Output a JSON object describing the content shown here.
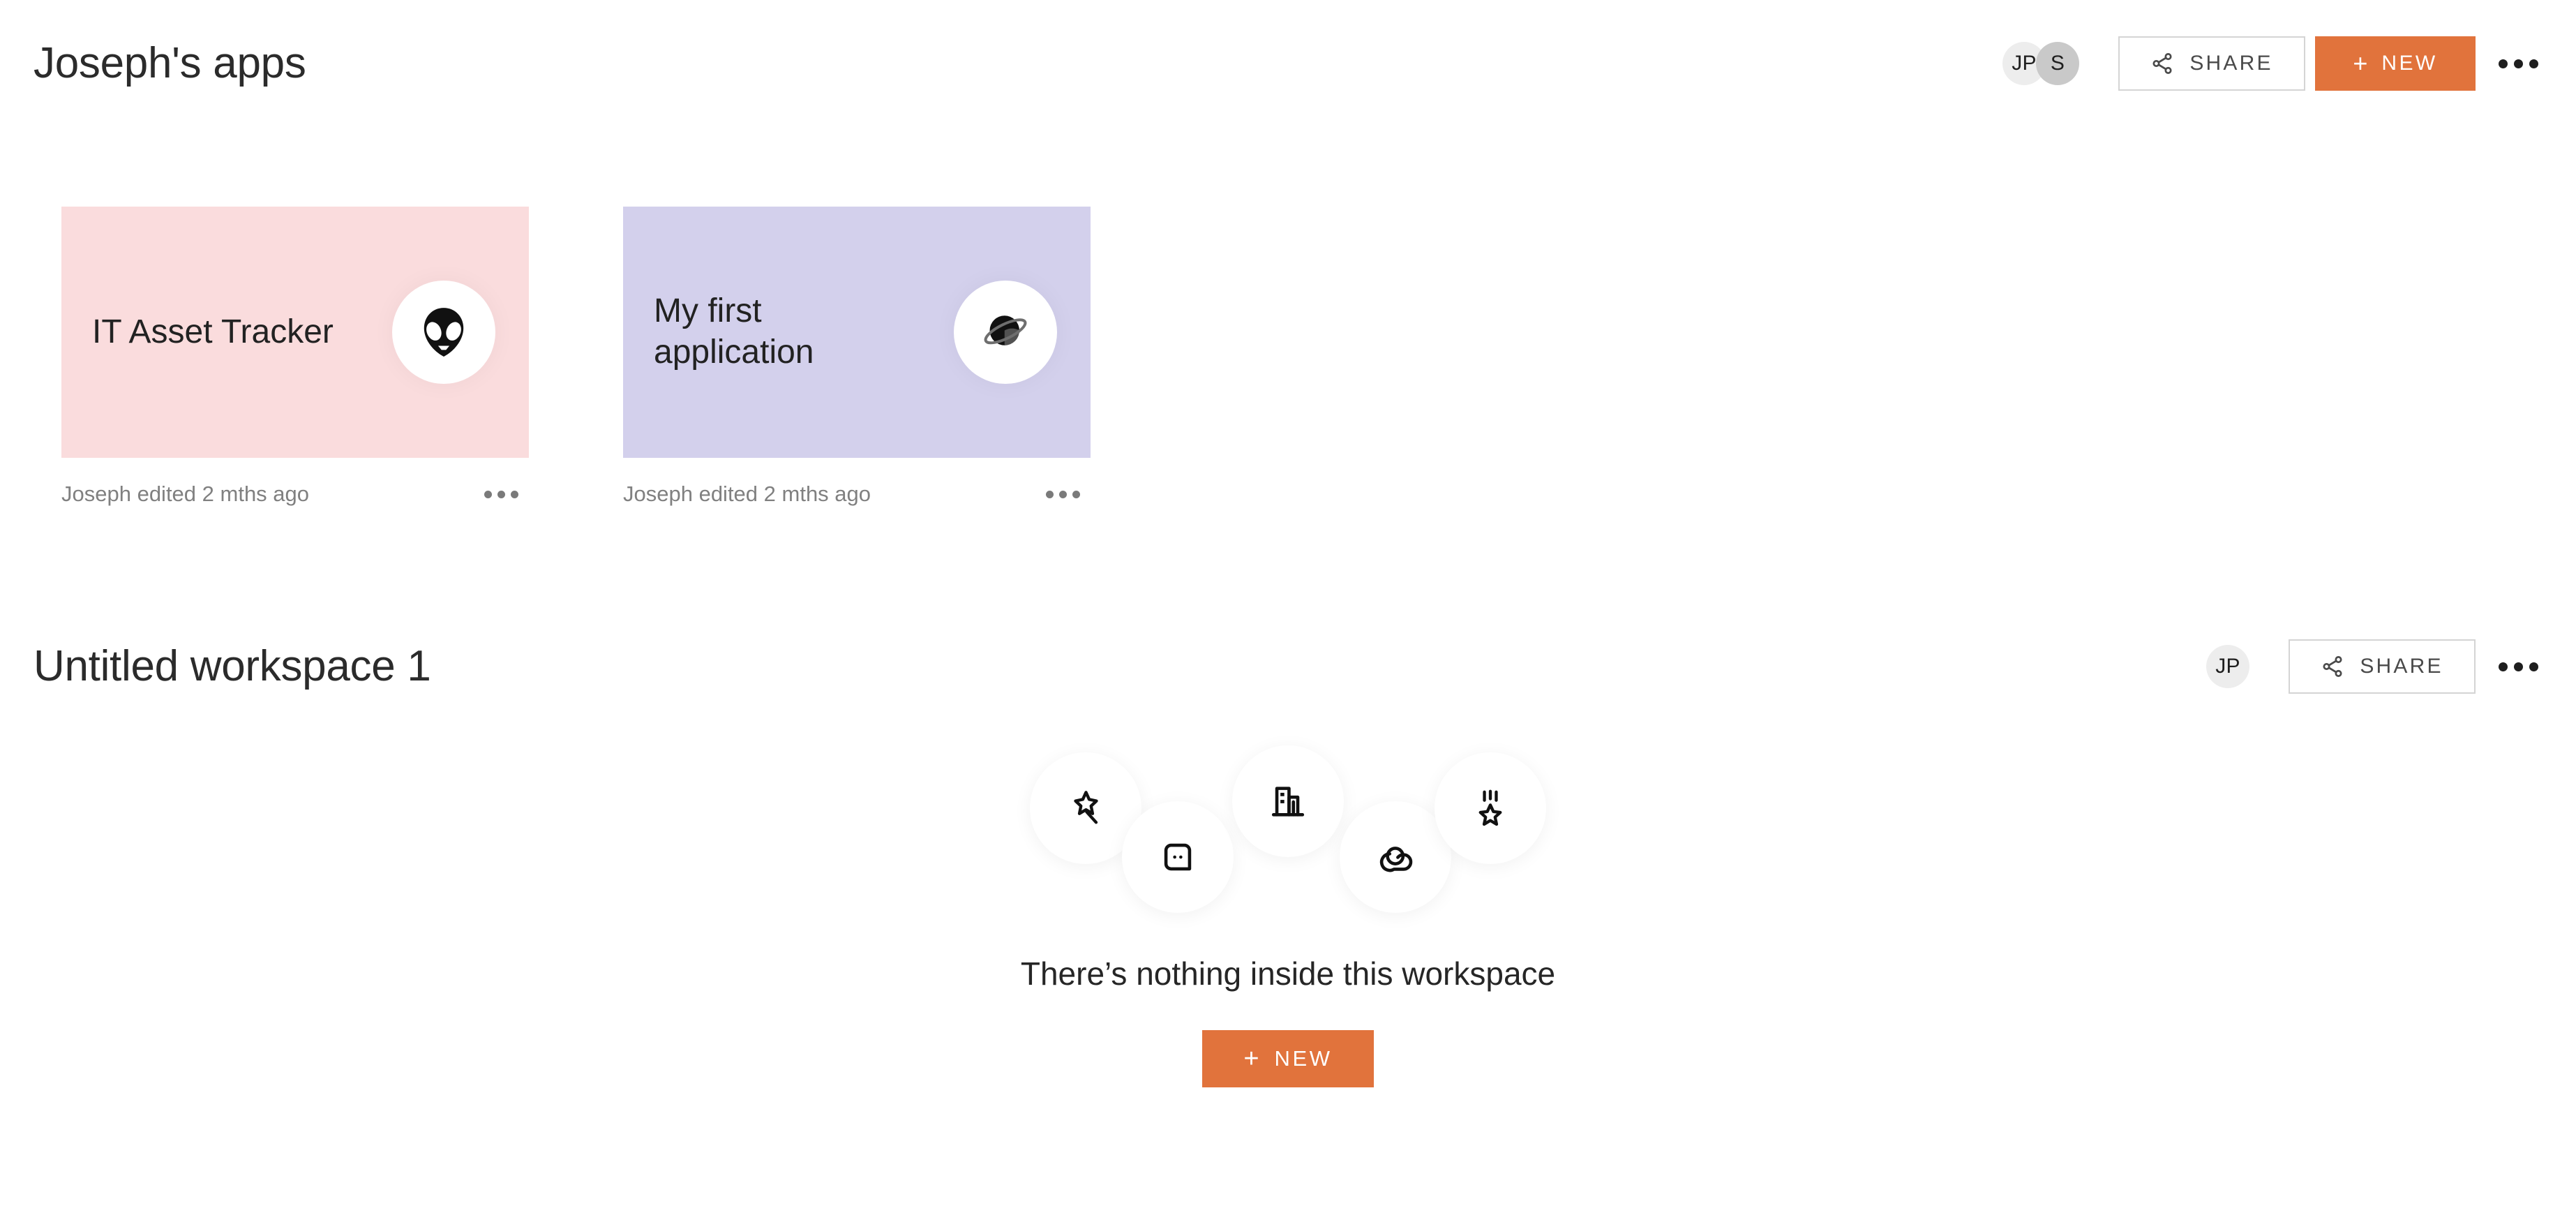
{
  "colors": {
    "accent_orange": "#E1733C",
    "card_pink": "#FADCDD",
    "card_purple": "#D3D0EC",
    "avatar_light": "#EDEDED",
    "avatar_dark": "#C9C9C9",
    "text_primary": "#262626",
    "text_muted": "#808080"
  },
  "apps_section": {
    "title": "Joseph's apps",
    "avatars": [
      {
        "initials": "JP",
        "tone": "light"
      },
      {
        "initials": "S",
        "tone": "dark"
      }
    ],
    "share_label": "SHARE",
    "new_label": "NEW",
    "new_plus": "+",
    "more_label": "more-options",
    "cards": [
      {
        "title": "IT Asset Tracker",
        "emoji_name": "alien-icon",
        "background": "#FADCDD",
        "meta": "Joseph edited 2 mths ago"
      },
      {
        "title": "My first application",
        "emoji_name": "ringed-planet-icon",
        "background": "#D3D0EC",
        "meta": "Joseph edited 2 mths ago"
      }
    ]
  },
  "workspace_section": {
    "title": "Untitled workspace 1",
    "avatars": [
      {
        "initials": "JP",
        "tone": "light"
      }
    ],
    "share_label": "SHARE",
    "more_label": "more-options",
    "empty_state": {
      "message": "There’s nothing inside this workspace",
      "new_label": "NEW",
      "new_plus": "+",
      "bubble_icons": [
        "magic-wand-sparkle-icon",
        "chat-bubble-icon",
        "building-icon",
        "cloud-icon",
        "shooting-star-icon"
      ]
    }
  }
}
